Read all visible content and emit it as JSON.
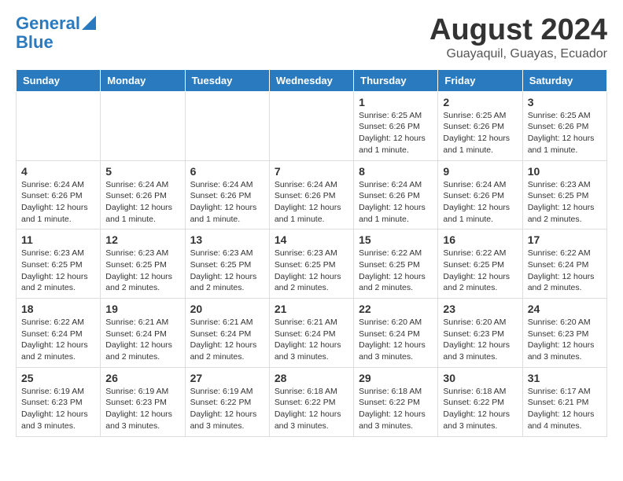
{
  "header": {
    "logo_line1": "General",
    "logo_line2": "Blue",
    "month_year": "August 2024",
    "location": "Guayaquil, Guayas, Ecuador"
  },
  "days_of_week": [
    "Sunday",
    "Monday",
    "Tuesday",
    "Wednesday",
    "Thursday",
    "Friday",
    "Saturday"
  ],
  "weeks": [
    [
      {
        "day": "",
        "info": ""
      },
      {
        "day": "",
        "info": ""
      },
      {
        "day": "",
        "info": ""
      },
      {
        "day": "",
        "info": ""
      },
      {
        "day": "1",
        "info": "Sunrise: 6:25 AM\nSunset: 6:26 PM\nDaylight: 12 hours and 1 minute."
      },
      {
        "day": "2",
        "info": "Sunrise: 6:25 AM\nSunset: 6:26 PM\nDaylight: 12 hours and 1 minute."
      },
      {
        "day": "3",
        "info": "Sunrise: 6:25 AM\nSunset: 6:26 PM\nDaylight: 12 hours and 1 minute."
      }
    ],
    [
      {
        "day": "4",
        "info": "Sunrise: 6:24 AM\nSunset: 6:26 PM\nDaylight: 12 hours and 1 minute."
      },
      {
        "day": "5",
        "info": "Sunrise: 6:24 AM\nSunset: 6:26 PM\nDaylight: 12 hours and 1 minute."
      },
      {
        "day": "6",
        "info": "Sunrise: 6:24 AM\nSunset: 6:26 PM\nDaylight: 12 hours and 1 minute."
      },
      {
        "day": "7",
        "info": "Sunrise: 6:24 AM\nSunset: 6:26 PM\nDaylight: 12 hours and 1 minute."
      },
      {
        "day": "8",
        "info": "Sunrise: 6:24 AM\nSunset: 6:26 PM\nDaylight: 12 hours and 1 minute."
      },
      {
        "day": "9",
        "info": "Sunrise: 6:24 AM\nSunset: 6:26 PM\nDaylight: 12 hours and 1 minute."
      },
      {
        "day": "10",
        "info": "Sunrise: 6:23 AM\nSunset: 6:25 PM\nDaylight: 12 hours and 2 minutes."
      }
    ],
    [
      {
        "day": "11",
        "info": "Sunrise: 6:23 AM\nSunset: 6:25 PM\nDaylight: 12 hours and 2 minutes."
      },
      {
        "day": "12",
        "info": "Sunrise: 6:23 AM\nSunset: 6:25 PM\nDaylight: 12 hours and 2 minutes."
      },
      {
        "day": "13",
        "info": "Sunrise: 6:23 AM\nSunset: 6:25 PM\nDaylight: 12 hours and 2 minutes."
      },
      {
        "day": "14",
        "info": "Sunrise: 6:23 AM\nSunset: 6:25 PM\nDaylight: 12 hours and 2 minutes."
      },
      {
        "day": "15",
        "info": "Sunrise: 6:22 AM\nSunset: 6:25 PM\nDaylight: 12 hours and 2 minutes."
      },
      {
        "day": "16",
        "info": "Sunrise: 6:22 AM\nSunset: 6:25 PM\nDaylight: 12 hours and 2 minutes."
      },
      {
        "day": "17",
        "info": "Sunrise: 6:22 AM\nSunset: 6:24 PM\nDaylight: 12 hours and 2 minutes."
      }
    ],
    [
      {
        "day": "18",
        "info": "Sunrise: 6:22 AM\nSunset: 6:24 PM\nDaylight: 12 hours and 2 minutes."
      },
      {
        "day": "19",
        "info": "Sunrise: 6:21 AM\nSunset: 6:24 PM\nDaylight: 12 hours and 2 minutes."
      },
      {
        "day": "20",
        "info": "Sunrise: 6:21 AM\nSunset: 6:24 PM\nDaylight: 12 hours and 2 minutes."
      },
      {
        "day": "21",
        "info": "Sunrise: 6:21 AM\nSunset: 6:24 PM\nDaylight: 12 hours and 3 minutes."
      },
      {
        "day": "22",
        "info": "Sunrise: 6:20 AM\nSunset: 6:24 PM\nDaylight: 12 hours and 3 minutes."
      },
      {
        "day": "23",
        "info": "Sunrise: 6:20 AM\nSunset: 6:23 PM\nDaylight: 12 hours and 3 minutes."
      },
      {
        "day": "24",
        "info": "Sunrise: 6:20 AM\nSunset: 6:23 PM\nDaylight: 12 hours and 3 minutes."
      }
    ],
    [
      {
        "day": "25",
        "info": "Sunrise: 6:19 AM\nSunset: 6:23 PM\nDaylight: 12 hours and 3 minutes."
      },
      {
        "day": "26",
        "info": "Sunrise: 6:19 AM\nSunset: 6:23 PM\nDaylight: 12 hours and 3 minutes."
      },
      {
        "day": "27",
        "info": "Sunrise: 6:19 AM\nSunset: 6:22 PM\nDaylight: 12 hours and 3 minutes."
      },
      {
        "day": "28",
        "info": "Sunrise: 6:18 AM\nSunset: 6:22 PM\nDaylight: 12 hours and 3 minutes."
      },
      {
        "day": "29",
        "info": "Sunrise: 6:18 AM\nSunset: 6:22 PM\nDaylight: 12 hours and 3 minutes."
      },
      {
        "day": "30",
        "info": "Sunrise: 6:18 AM\nSunset: 6:22 PM\nDaylight: 12 hours and 3 minutes."
      },
      {
        "day": "31",
        "info": "Sunrise: 6:17 AM\nSunset: 6:21 PM\nDaylight: 12 hours and 4 minutes."
      }
    ]
  ]
}
